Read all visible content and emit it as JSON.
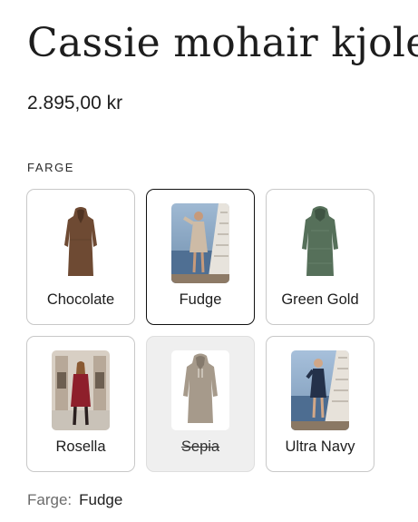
{
  "product": {
    "title": "Cassie mohair kjole",
    "price": "2.895,00 kr"
  },
  "color_picker": {
    "label": "FARGE",
    "options": [
      {
        "name": "Chocolate",
        "image": "chocolate-dress",
        "state": "available"
      },
      {
        "name": "Fudge",
        "image": "fudge-model-photo",
        "state": "selected"
      },
      {
        "name": "Green Gold",
        "image": "green-gold-dress",
        "state": "available"
      },
      {
        "name": "Rosella",
        "image": "rosella-model-photo",
        "state": "available"
      },
      {
        "name": "Sepia",
        "image": "sepia-dress",
        "state": "sold-out"
      },
      {
        "name": "Ultra Navy",
        "image": "ultra-navy-model-photo",
        "state": "available"
      }
    ],
    "selected_label": "Farge:",
    "selected_value": "Fudge"
  },
  "colors": {
    "text": "#1d1d1d",
    "border": "#c8c8c8",
    "selected_border": "#111111",
    "disabled_bg": "#efefef"
  }
}
